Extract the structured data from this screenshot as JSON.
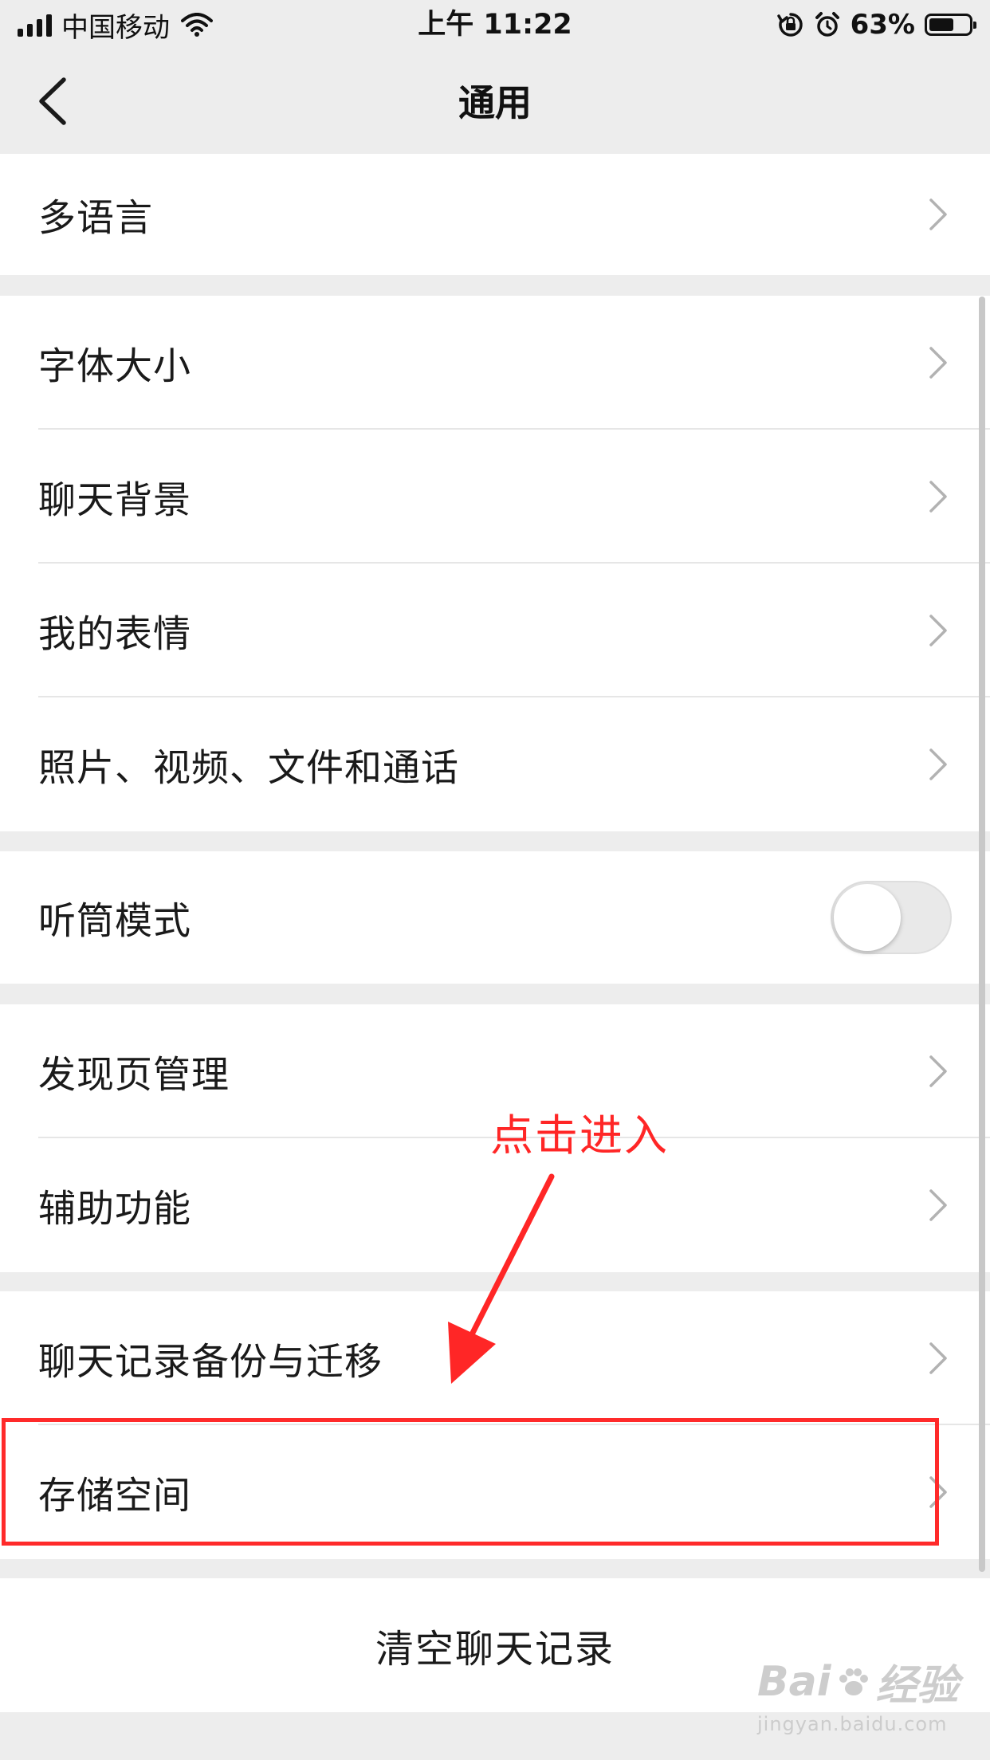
{
  "status_bar": {
    "carrier": "中国移动",
    "time": "上午 11:22",
    "battery_percent": "63%",
    "battery_level": 0.63
  },
  "nav": {
    "title": "通用",
    "back_icon": "chevron-left-icon"
  },
  "groups": [
    {
      "items": [
        {
          "label": "多语言",
          "type": "link"
        }
      ]
    },
    {
      "items": [
        {
          "label": "字体大小",
          "type": "link"
        },
        {
          "label": "聊天背景",
          "type": "link"
        },
        {
          "label": "我的表情",
          "type": "link"
        },
        {
          "label": "照片、视频、文件和通话",
          "type": "link"
        }
      ]
    },
    {
      "items": [
        {
          "label": "听筒模式",
          "type": "toggle",
          "value": false
        }
      ]
    },
    {
      "items": [
        {
          "label": "发现页管理",
          "type": "link"
        },
        {
          "label": "辅助功能",
          "type": "link"
        }
      ]
    },
    {
      "items": [
        {
          "label": "聊天记录备份与迁移",
          "type": "link"
        },
        {
          "label": "存储空间",
          "type": "link"
        }
      ]
    }
  ],
  "clear_button": {
    "label": "清空聊天记录"
  },
  "annotation": {
    "text": "点击进入",
    "color": "#ff2626"
  },
  "watermark": {
    "main_prefix": "Bai",
    "main_suffix": "经验",
    "sub": "jingyan.baidu.com"
  },
  "colors": {
    "background": "#ededed",
    "cell": "#ffffff",
    "highlight": "#ff2a2a"
  }
}
